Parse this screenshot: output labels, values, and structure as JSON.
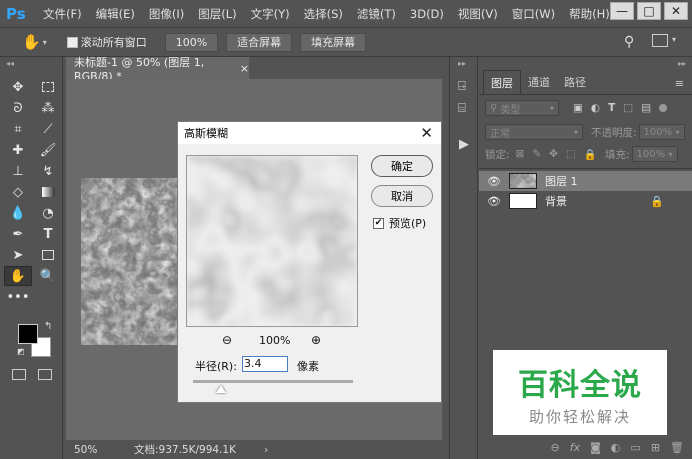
{
  "app": {
    "logo": "Ps"
  },
  "menu": [
    "文件(F)",
    "编辑(E)",
    "图像(I)",
    "图层(L)",
    "文字(Y)",
    "选择(S)",
    "滤镜(T)",
    "3D(D)",
    "视图(V)",
    "窗口(W)",
    "帮助(H)"
  ],
  "options": {
    "scroll_all": "滚动所有窗口",
    "zoom": "100%",
    "fit_screen": "适合屏幕",
    "fill_screen": "填充屏幕"
  },
  "document": {
    "tab_title": "未标题-1 @ 50% (图层 1, RGB/8) *",
    "close": "×",
    "zoom": "50%",
    "doc_info": "文档:937.5K/994.1K"
  },
  "panel": {
    "tabs": [
      "图层",
      "通道",
      "路径"
    ],
    "kind": "类型",
    "blend_mode": "正常",
    "opacity_label": "不透明度:",
    "opacity": "100%",
    "lock_label": "锁定:",
    "fill_label": "填充:",
    "fill": "100%",
    "layers": [
      {
        "name": "图层 1"
      },
      {
        "name": "背景"
      }
    ]
  },
  "dialog": {
    "title": "高斯模糊",
    "ok": "确定",
    "cancel": "取消",
    "preview_label": "预览(P)",
    "preview_checked": true,
    "zoom": "100%",
    "radius_label": "半径(R):",
    "radius_value": "3.4",
    "unit": "像素"
  },
  "watermark": {
    "title": "百科全说",
    "subtitle": "助你轻松解决"
  }
}
